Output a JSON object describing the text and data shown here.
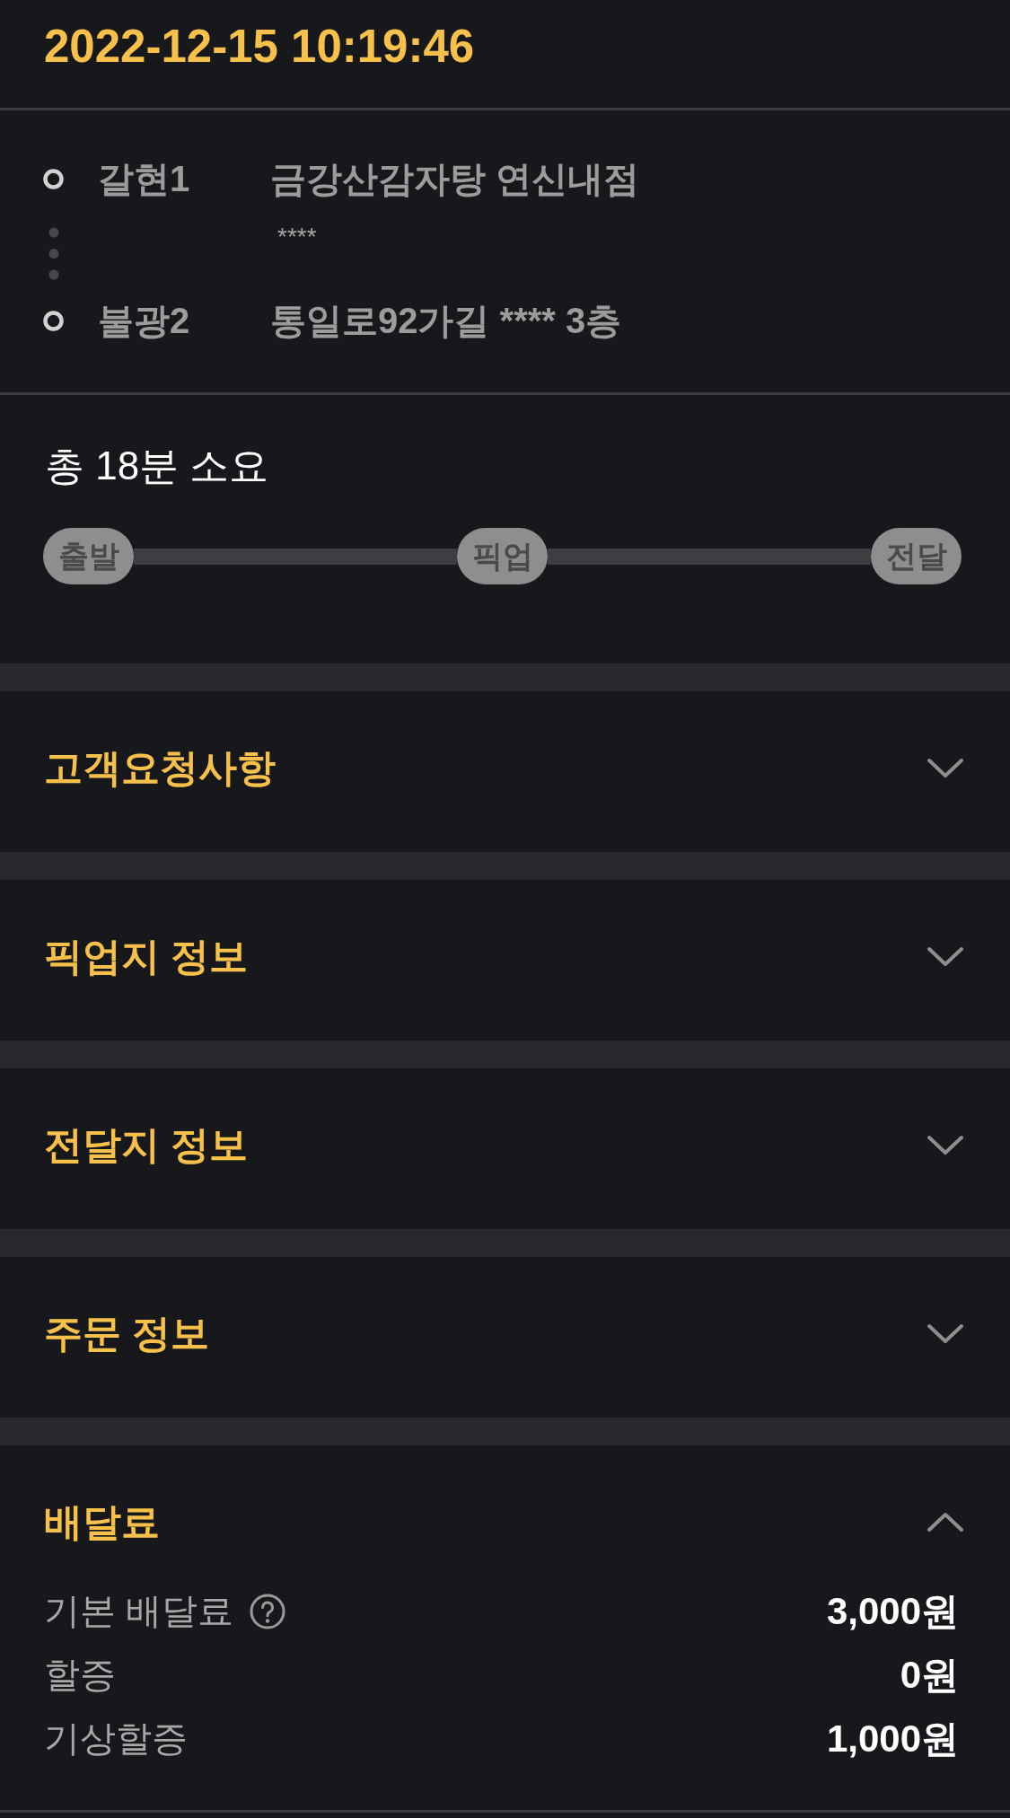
{
  "header": {
    "timestamp": "2022-12-15 10:19:46"
  },
  "route": {
    "stops": [
      {
        "area": "갈현1",
        "address": "금강산감자탕 연신내점",
        "detail": "****"
      },
      {
        "area": "불광2",
        "address": "통일로92가길 **** 3층"
      }
    ]
  },
  "trip": {
    "summary": "총 18분 소요",
    "steps": [
      {
        "label": "출발"
      },
      {
        "label": "픽업"
      },
      {
        "label": "전달"
      }
    ]
  },
  "sections": [
    {
      "title": "고객요청사항",
      "expanded": false
    },
    {
      "title": "픽업지 정보",
      "expanded": false
    },
    {
      "title": "전달지 정보",
      "expanded": false
    },
    {
      "title": "주문 정보",
      "expanded": false
    },
    {
      "title": "배달료",
      "expanded": true,
      "rows": [
        {
          "label": "기본 배달료",
          "help": true,
          "value": "3,000원"
        },
        {
          "label": "할증",
          "help": false,
          "value": "0원"
        },
        {
          "label": "기상할증",
          "help": false,
          "value": "1,000원"
        }
      ]
    }
  ]
}
